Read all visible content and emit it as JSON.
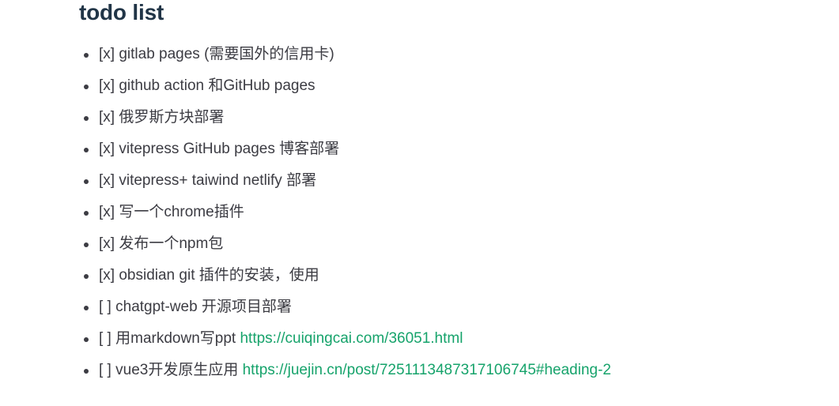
{
  "heading": "todo list",
  "items": [
    {
      "status": "[x]",
      "text": "gitlab pages (需要国外的信用卡)",
      "link": ""
    },
    {
      "status": "[x]",
      "text": "github action 和GitHub pages",
      "link": ""
    },
    {
      "status": "[x]",
      "text": "俄罗斯方块部署",
      "link": ""
    },
    {
      "status": "[x]",
      "text": "vitepress GitHub pages 博客部署",
      "link": ""
    },
    {
      "status": "[x]",
      "text": "vitepress+ taiwind netlify 部署",
      "link": ""
    },
    {
      "status": "[x]",
      "text": "写一个chrome插件",
      "link": ""
    },
    {
      "status": "[x]",
      "text": "发布一个npm包",
      "link": ""
    },
    {
      "status": "[x]",
      "text": "obsidian git 插件的安装，使用",
      "link": ""
    },
    {
      "status": "[ ]",
      "text": "chatgpt-web 开源项目部署",
      "link": ""
    },
    {
      "status": "[ ]",
      "text": "用markdown写ppt",
      "link": "https://cuiqingcai.com/36051.html"
    },
    {
      "status": "[ ]",
      "text": "vue3开发原生应用",
      "link": "https://juejin.cn/post/7251113487317106745#heading-2"
    }
  ],
  "colors": {
    "text": "#3c3c43",
    "heading": "#213547",
    "link": "#16a36b"
  }
}
